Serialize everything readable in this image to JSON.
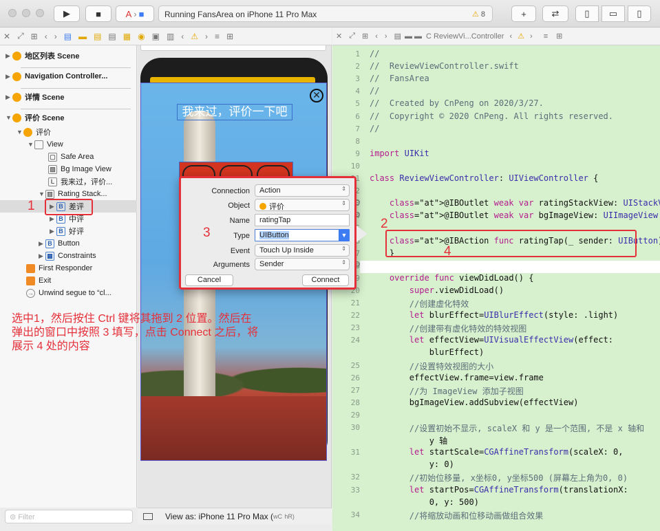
{
  "toolbar": {
    "scheme": "Running FansArea on iPhone 11 Pro Max",
    "warnings": "8"
  },
  "navigator": {
    "scenes": [
      {
        "label": "地区列表 Scene"
      },
      {
        "label": "Navigation Controller..."
      },
      {
        "label": "详情 Scene"
      },
      {
        "label": "评价 Scene"
      }
    ],
    "tree": {
      "review": "评价",
      "view": "View",
      "safe_area": "Safe Area",
      "bg_image": "Bg Image View",
      "label": "我来过，评价...",
      "rating_stack": "Rating Stack...",
      "bad": "差评",
      "mid": "中评",
      "good": "好评",
      "button": "Button",
      "constraints": "Constraints",
      "first_responder": "First Responder",
      "exit": "Exit",
      "unwind": "Unwind segue to “cl..."
    },
    "filter_placeholder": "Filter"
  },
  "canvas": {
    "title": "我来过，评价一下吧",
    "view_as": "View as: iPhone 11 Pro Max (",
    "view_as_wc": "wC",
    "view_as_hr": "hR)"
  },
  "dialog": {
    "labels": {
      "connection": "Connection",
      "object": "Object",
      "name": "Name",
      "type": "Type",
      "event": "Event",
      "arguments": "Arguments"
    },
    "values": {
      "connection": "Action",
      "object": "评价",
      "name": "ratingTap",
      "type": "UIButton",
      "event": "Touch Up Inside",
      "arguments": "Sender"
    },
    "cancel": "Cancel",
    "connect": "Connect"
  },
  "editor": {
    "jumpbar": "ReviewVi...Controller"
  },
  "code_lines": [
    {
      "n": "1",
      "t": "//"
    },
    {
      "n": "2",
      "t": "//  ReviewViewController.swift"
    },
    {
      "n": "3",
      "t": "//  FansArea"
    },
    {
      "n": "4",
      "t": "//"
    },
    {
      "n": "5",
      "t": "//  Created by CnPeng on 2020/3/27."
    },
    {
      "n": "6",
      "t": "//  Copyright © 2020 CnPeng. All rights reserved."
    },
    {
      "n": "7",
      "t": "//"
    },
    {
      "n": "8",
      "t": ""
    },
    {
      "n": "9",
      "t": "import UIKit"
    },
    {
      "n": "10",
      "t": ""
    },
    {
      "n": "11",
      "t": "class ReviewViewController: UIViewController {"
    },
    {
      "n": "12",
      "t": ""
    },
    {
      "n": "13",
      "t": "    @IBOutlet weak var ratingStackView: UIStackView!"
    },
    {
      "n": "14",
      "t": "    @IBOutlet weak var bgImageView: UIImageView!"
    },
    {
      "n": "15",
      "t": ""
    },
    {
      "n": "16",
      "t": "    @IBAction func ratingTap(_ sender: UIButton) {"
    },
    {
      "n": "17",
      "t": "    }"
    },
    {
      "n": "18",
      "t": ""
    },
    {
      "n": "19",
      "t": "    override func viewDidLoad() {"
    },
    {
      "n": "20",
      "t": "        super.viewDidLoad()"
    },
    {
      "n": "21",
      "t": "        //创建虚化特效"
    },
    {
      "n": "22",
      "t": "        let blurEffect=UIBlurEffect(style: .light)"
    },
    {
      "n": "23",
      "t": "        //创建带有虚化特效的特效视图"
    },
    {
      "n": "24",
      "t": "        let effectView=UIVisualEffectView(effect:"
    },
    {
      "n": "",
      "t": "            blurEffect)"
    },
    {
      "n": "25",
      "t": "        //设置特效视图的大小"
    },
    {
      "n": "26",
      "t": "        effectView.frame=view.frame"
    },
    {
      "n": "27",
      "t": "        //为 ImageView 添加子视图"
    },
    {
      "n": "28",
      "t": "        bgImageView.addSubview(effectView)"
    },
    {
      "n": "29",
      "t": ""
    },
    {
      "n": "30",
      "t": "        //设置初始不显示, scaleX 和 y 是一个范围, 不是 x 轴和"
    },
    {
      "n": "",
      "t": "            y 轴"
    },
    {
      "n": "31",
      "t": "        let startScale=CGAffineTransform(scaleX: 0,"
    },
    {
      "n": "",
      "t": "            y: 0)"
    },
    {
      "n": "32",
      "t": "        //初始位移量, x坐标0, y坐标500 (屏幕左上角为0, 0)"
    },
    {
      "n": "33",
      "t": "        let startPos=CGAffineTransform(translationX:"
    },
    {
      "n": "",
      "t": "            0, y: 500)"
    },
    {
      "n": "34",
      "t": "        //将缩放动画和位移动画做组合效果"
    }
  ],
  "annotations": {
    "n1": "1",
    "n2": "2",
    "n3": "3",
    "n4": "4",
    "note": "选中1，然后按住 Ctrl 键将其拖到 2 位置。然后在弹出的窗口中按照 3 填写，点击 Connect 之后，将展示 4 处的内容"
  },
  "colors": {
    "editor_bg": "#d7f0cd",
    "annotation": "#e5303a",
    "accent": "#3d7cf3"
  }
}
